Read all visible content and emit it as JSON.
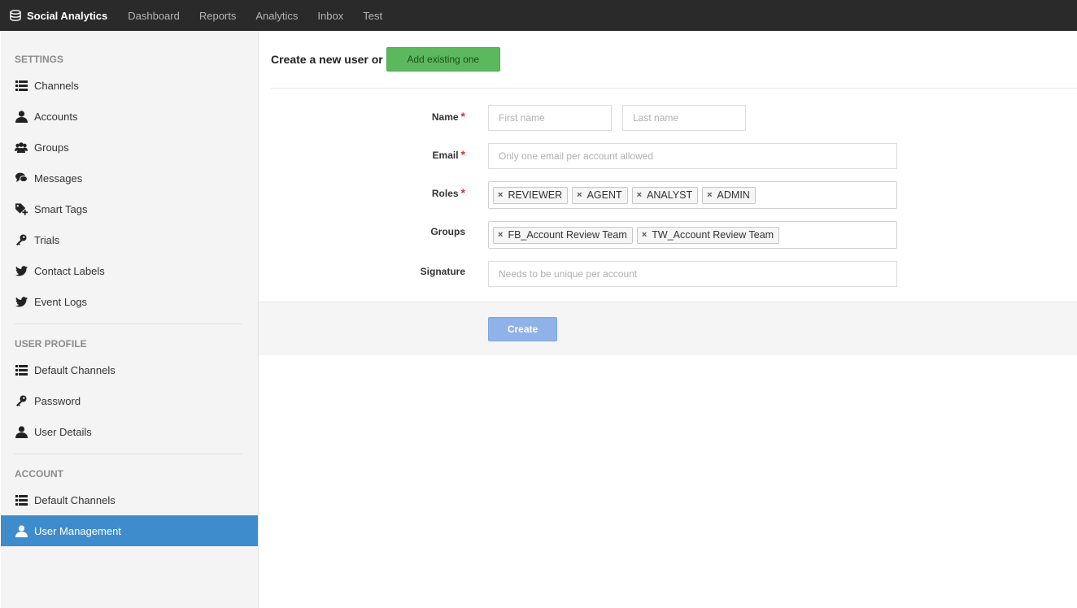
{
  "app": {
    "title": "Social Analytics"
  },
  "nav": [
    "Dashboard",
    "Reports",
    "Analytics",
    "Inbox",
    "Test"
  ],
  "sidebar": {
    "settings_title": "SETTINGS",
    "settings": [
      "Channels",
      "Accounts",
      "Groups",
      "Messages",
      "Smart Tags",
      "Trials",
      "Contact Labels",
      "Event Logs"
    ],
    "profile_title": "USER PROFILE",
    "profile": [
      "Default Channels",
      "Password",
      "User Details"
    ],
    "account_title": "ACCOUNT",
    "account": [
      "Default Channels",
      "User Management"
    ]
  },
  "form": {
    "heading": "Create a new user or",
    "add_existing": "Add existing one",
    "name_label": "Name",
    "first_placeholder": "First name",
    "last_placeholder": "Last name",
    "email_label": "Email",
    "email_placeholder": "Only one email per account allowed",
    "roles_label": "Roles",
    "roles": [
      "REVIEWER",
      "AGENT",
      "ANALYST",
      "ADMIN"
    ],
    "groups_label": "Groups",
    "groups": [
      "FB_Account Review Team",
      "TW_Account Review Team"
    ],
    "signature_label": "Signature",
    "signature_placeholder": "Needs to be unique per account",
    "required_mark": "*",
    "remove_mark": "×",
    "create": "Create"
  },
  "colors": {
    "active": "#3f8ccd",
    "green": "#5cb85c",
    "create": "#8fb3e9",
    "required": "#d9302c"
  }
}
